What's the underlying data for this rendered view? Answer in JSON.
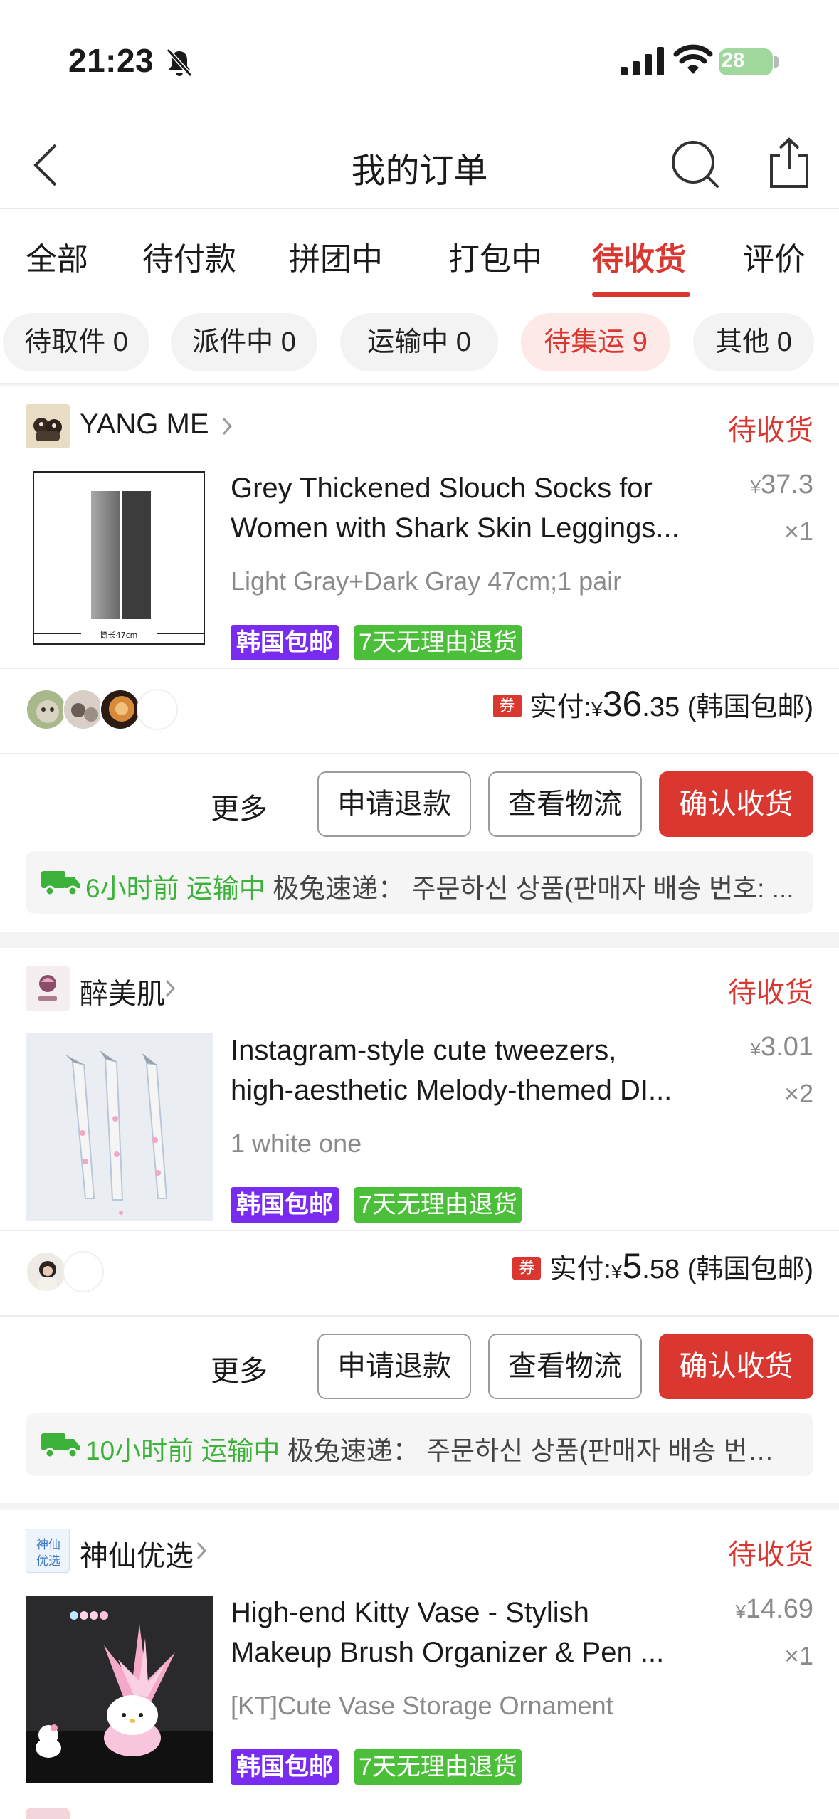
{
  "status_bar": {
    "time": "21:23",
    "battery": "28"
  },
  "nav": {
    "title": "我的订单"
  },
  "tabs": [
    {
      "label": "全部"
    },
    {
      "label": "待付款"
    },
    {
      "label": "拼团中"
    },
    {
      "label": "打包中"
    },
    {
      "label": "待收货"
    },
    {
      "label": "评价"
    }
  ],
  "active_tab": "待收货",
  "chips": [
    {
      "label": "待取件 0"
    },
    {
      "label": "派件中 0"
    },
    {
      "label": "运输中 0"
    },
    {
      "label": "待集运 9"
    },
    {
      "label": "其他 0"
    }
  ],
  "colors": {
    "accent": "#d9372f",
    "green": "#3db23a",
    "purple_badge": "#7a2bf0",
    "green_badge": "#4cbf3a"
  },
  "orders": [
    {
      "shop": "YANG ME",
      "status": "待收货",
      "title_line1": "Grey Thickened Slouch Socks for",
      "title_line2": "Women with Shark Skin Leggings...",
      "price_yen": "¥",
      "price": "37.3",
      "qty": "×1",
      "variant": "Light Gray+Dark Gray 47cm;1 pair",
      "thumb_caption": "筒长47cm",
      "badge_ship": "韩国包邮",
      "badge_return": "7天无理由退货",
      "coupon": "券",
      "paid_label": "实付:",
      "paid_yen": "¥",
      "paid_big": "36",
      "paid_small": ".35",
      "paid_note": "(韩国包邮)",
      "more": "更多",
      "btn_refund": "申请退款",
      "btn_logistics": "查看物流",
      "btn_confirm": "确认收货",
      "log_time": "6小时前",
      "log_status": "运输中",
      "log_detail": "极兔速递：  주문하신 상품(판매자 배송 번호: ..."
    },
    {
      "shop": "醉美肌",
      "status": "待收货",
      "title_line1": "Instagram-style cute tweezers,",
      "title_line2": "high-aesthetic Melody-themed DI...",
      "price_yen": "¥",
      "price": "3.01",
      "qty": "×2",
      "variant": "1 white one",
      "badge_ship": "韩国包邮",
      "badge_return": "7天无理由退货",
      "coupon": "券",
      "paid_label": "实付:",
      "paid_yen": "¥",
      "paid_big": "5",
      "paid_small": ".58",
      "paid_note": "(韩国包邮)",
      "more": "更多",
      "btn_refund": "申请退款",
      "btn_logistics": "查看物流",
      "btn_confirm": "确认收货",
      "log_time": "10小时前",
      "log_status": "运输中",
      "log_detail": "极兔速递：  주문하신 상품(판매자 배송 번호:..."
    },
    {
      "shop": "神仙优选",
      "shop_logo_text": "神仙优选",
      "status": "待收货",
      "title_line1": "High-end Kitty Vase - Stylish",
      "title_line2": "Makeup Brush Organizer & Pen ...",
      "price_yen": "¥",
      "price": "14.69",
      "qty": "×1",
      "variant": "[KT]Cute Vase Storage Ornament",
      "badge_ship": "韩国包邮",
      "badge_return": "7天无理由退货"
    }
  ]
}
